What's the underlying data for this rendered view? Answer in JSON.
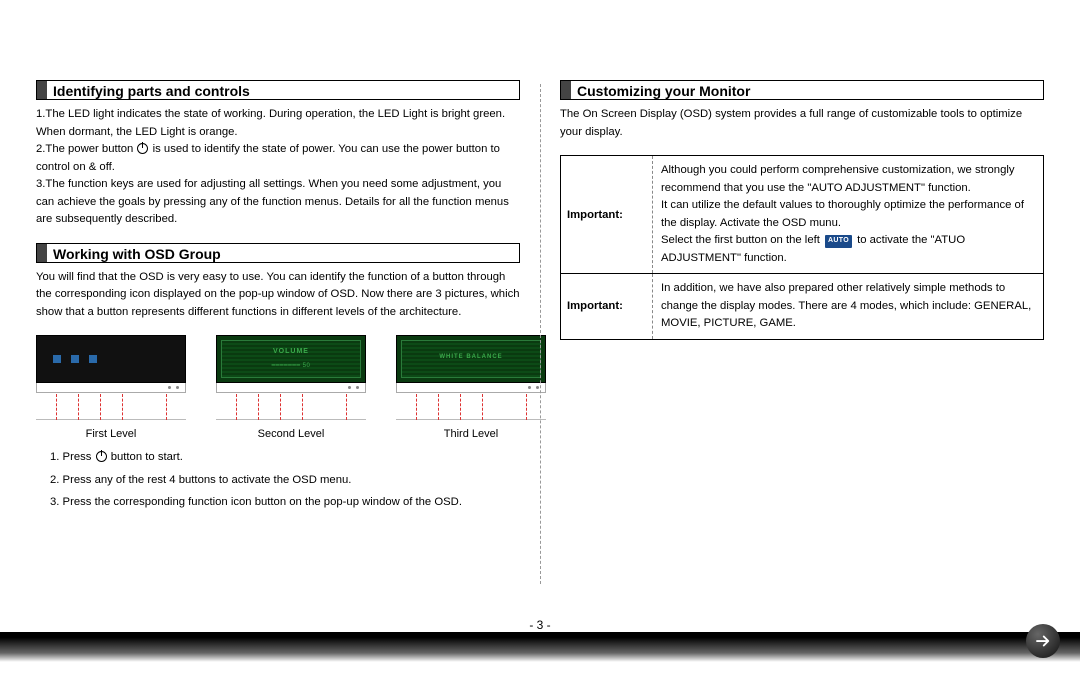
{
  "left": {
    "section1": {
      "title": "Identifying parts and controls",
      "p1a": "1.The LED light indicates the state of working. During operation, the LED Light is bright green. When dormant, the LED Light is orange.",
      "p2a": "2.The power button ",
      "p2b": " is used to identify the state of power. You can use the power button to control on & off.",
      "p3": "3.The function keys are used for adjusting all settings. When you need some adjustment, you can achieve the goals by pressing any of the function menus. Details for all the function menus are subsequently described."
    },
    "section2": {
      "title": "Working with OSD Group",
      "body": "You will find that the OSD is very easy to use. You can identify the function of a button through the corresponding icon displayed on the pop-up window of OSD. Now there are 3 pictures, which show that a button represents different functions in different levels of the architecture.",
      "levels": {
        "l1": "First Level",
        "l2": "Second Level",
        "l3": "Third Level",
        "screen2_title": "VOLUME",
        "screen2_sub": "━━━━━━━  50",
        "screen3_title": "WHITE  BALANCE"
      },
      "steps": {
        "s1a": "1. Press ",
        "s1b": " button to start.",
        "s2": "2. Press any of the rest 4 buttons to activate the OSD menu.",
        "s3": "3. Press the corresponding function icon button on the pop-up window of the OSD."
      }
    }
  },
  "right": {
    "section1": {
      "title": "Customizing your Monitor",
      "body": "The On Screen Display (OSD) system provides a full range of customizable tools to optimize your display."
    },
    "table": {
      "r1_label": "Important:",
      "r1_p1": "Although you could perform comprehensive customization, we strongly recommend that you use the \"AUTO ADJUSTMENT\" function.",
      "r1_p2": "It can utilize the default values to thoroughly optimize the performance of the display. Activate the OSD munu.",
      "r1_p3a": "Select the first button on the left ",
      "r1_p3_badge": "AUTO",
      "r1_p3b": " to activate the \"ATUO ADJUSTMENT\" function.",
      "r2_label": "Important:",
      "r2_body": "In addition, we have also prepared other relatively simple methods to change the display modes. There are 4 modes, which include: GENERAL, MOVIE, PICTURE, GAME."
    }
  },
  "page_number": "- 3 -"
}
